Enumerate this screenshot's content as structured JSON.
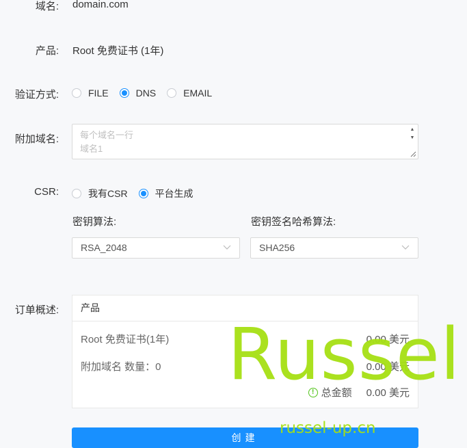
{
  "domain": {
    "label": "域名:",
    "value": "domain.com"
  },
  "product": {
    "label": "产品:",
    "value": "Root 免费证书 (1年)"
  },
  "verify": {
    "label": "验证方式:",
    "options": [
      {
        "label": "FILE",
        "checked": false
      },
      {
        "label": "DNS",
        "checked": true
      },
      {
        "label": "EMAIL",
        "checked": false
      }
    ]
  },
  "extra_domains": {
    "label": "附加域名:",
    "placeholder_line1": "每个域名一行",
    "placeholder_line2": "域名1"
  },
  "csr": {
    "label": "CSR:",
    "options": [
      {
        "label": "我有CSR",
        "checked": false
      },
      {
        "label": "平台生成",
        "checked": true
      }
    ]
  },
  "key_algo": {
    "label": "密钥算法:",
    "value": "RSA_2048"
  },
  "hash_algo": {
    "label": "密钥签名哈希算法:",
    "value": "SHA256"
  },
  "order": {
    "label": "订单概述:",
    "header": "产品",
    "rows": [
      {
        "name": "Root 免费证书(1年)",
        "amount": "0.00 美元"
      },
      {
        "name": "附加域名 数量：0",
        "amount": "0.00 美元"
      }
    ],
    "total_label": "总金额",
    "total_amount": "0.00 美元"
  },
  "create_button": "创建",
  "watermark": {
    "big": "Russel",
    "small": "russel-up.cn"
  },
  "colors": {
    "primary": "#1890ff",
    "watermark": "#a6e014",
    "info": "#52c41a"
  }
}
